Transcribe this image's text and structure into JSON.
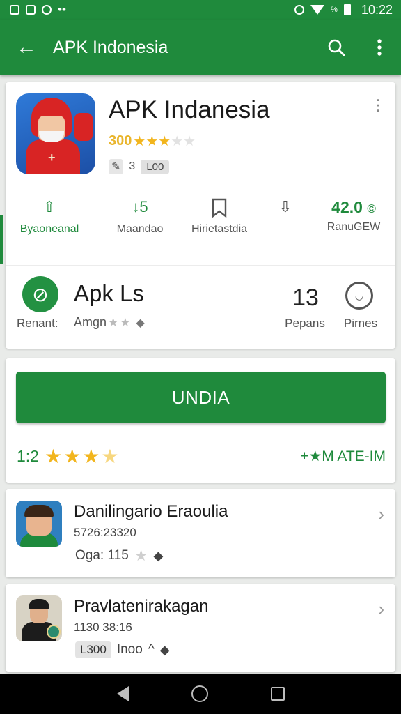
{
  "status_bar": {
    "time": "10:22",
    "battery_text": "%",
    "icons": [
      "notification-d-icon",
      "notification-face-icon",
      "notification-ring-icon",
      "notification-dots-icon",
      "alarm-icon",
      "wifi-icon",
      "signal-icon",
      "battery-icon"
    ]
  },
  "app_bar": {
    "title": "APK Indonesia",
    "back_icon": "arrow-left-icon",
    "search_icon": "search-icon",
    "menu_icon": "more-vert-icon"
  },
  "app": {
    "title": "APK Indanesia",
    "rating_text": "300",
    "rating_value": 3.5,
    "tag_count": "3",
    "chip": "L00",
    "stats": [
      {
        "icon": "upload-icon",
        "icon_text": "⇧",
        "label": "Byaoneanal"
      },
      {
        "icon": "count-icon",
        "icon_text": "↓5",
        "label": "Maandao"
      },
      {
        "icon": "bookmark-icon",
        "icon_text": "🔖",
        "label": "Hirietastdia"
      },
      {
        "icon": "download-icon",
        "icon_text": "⇩",
        "label": ""
      },
      {
        "value": "42.0",
        "label": "RanuGEW"
      }
    ]
  },
  "developer": {
    "name": "Apk Ls",
    "label": "Renant:",
    "sub": "Amgn",
    "count": "13",
    "count_label": "Pepans",
    "chat_label": "Pirnes"
  },
  "install": {
    "button": "UNDIA",
    "rating": "1:2",
    "rating_value": 3.5,
    "team": "+★M ATE-IM"
  },
  "list": [
    {
      "title": "Danilingario Eraoulia",
      "sub": "5726:23320",
      "meta": "Oga: 115"
    },
    {
      "title": "Pravlatenirakagan",
      "sub": "1130 38:16",
      "chip": "L300",
      "meta": "Inoo"
    }
  ],
  "colors": {
    "primary": "#1f8a3c",
    "star": "#f2b51d",
    "background": "#e9ebe9"
  }
}
